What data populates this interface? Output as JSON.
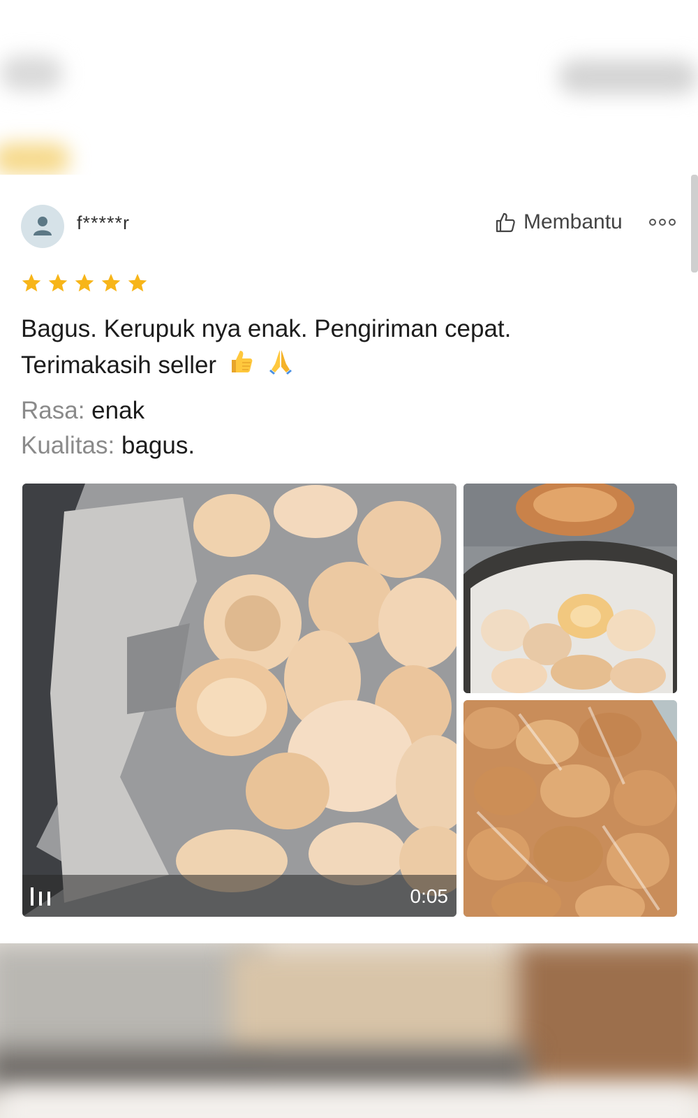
{
  "review": {
    "username": "f*****r",
    "helpful_label": "Membantu",
    "rating": 5,
    "max_rating": 5,
    "text_line1": "Bagus. Kerupuk nya enak. Pengiriman cepat.",
    "text_line2": "Terimakasih seller",
    "emojis": [
      "thumbs-up",
      "folded-hands"
    ],
    "attributes": [
      {
        "key": "Rasa:",
        "value": "enak"
      },
      {
        "key": "Kualitas:",
        "value": "bagus."
      }
    ],
    "media": {
      "video_duration": "0:05"
    }
  },
  "colors": {
    "star": "#f7b519",
    "avatar_bg": "#d6e2e8",
    "attr_key": "#8a8a8a"
  }
}
